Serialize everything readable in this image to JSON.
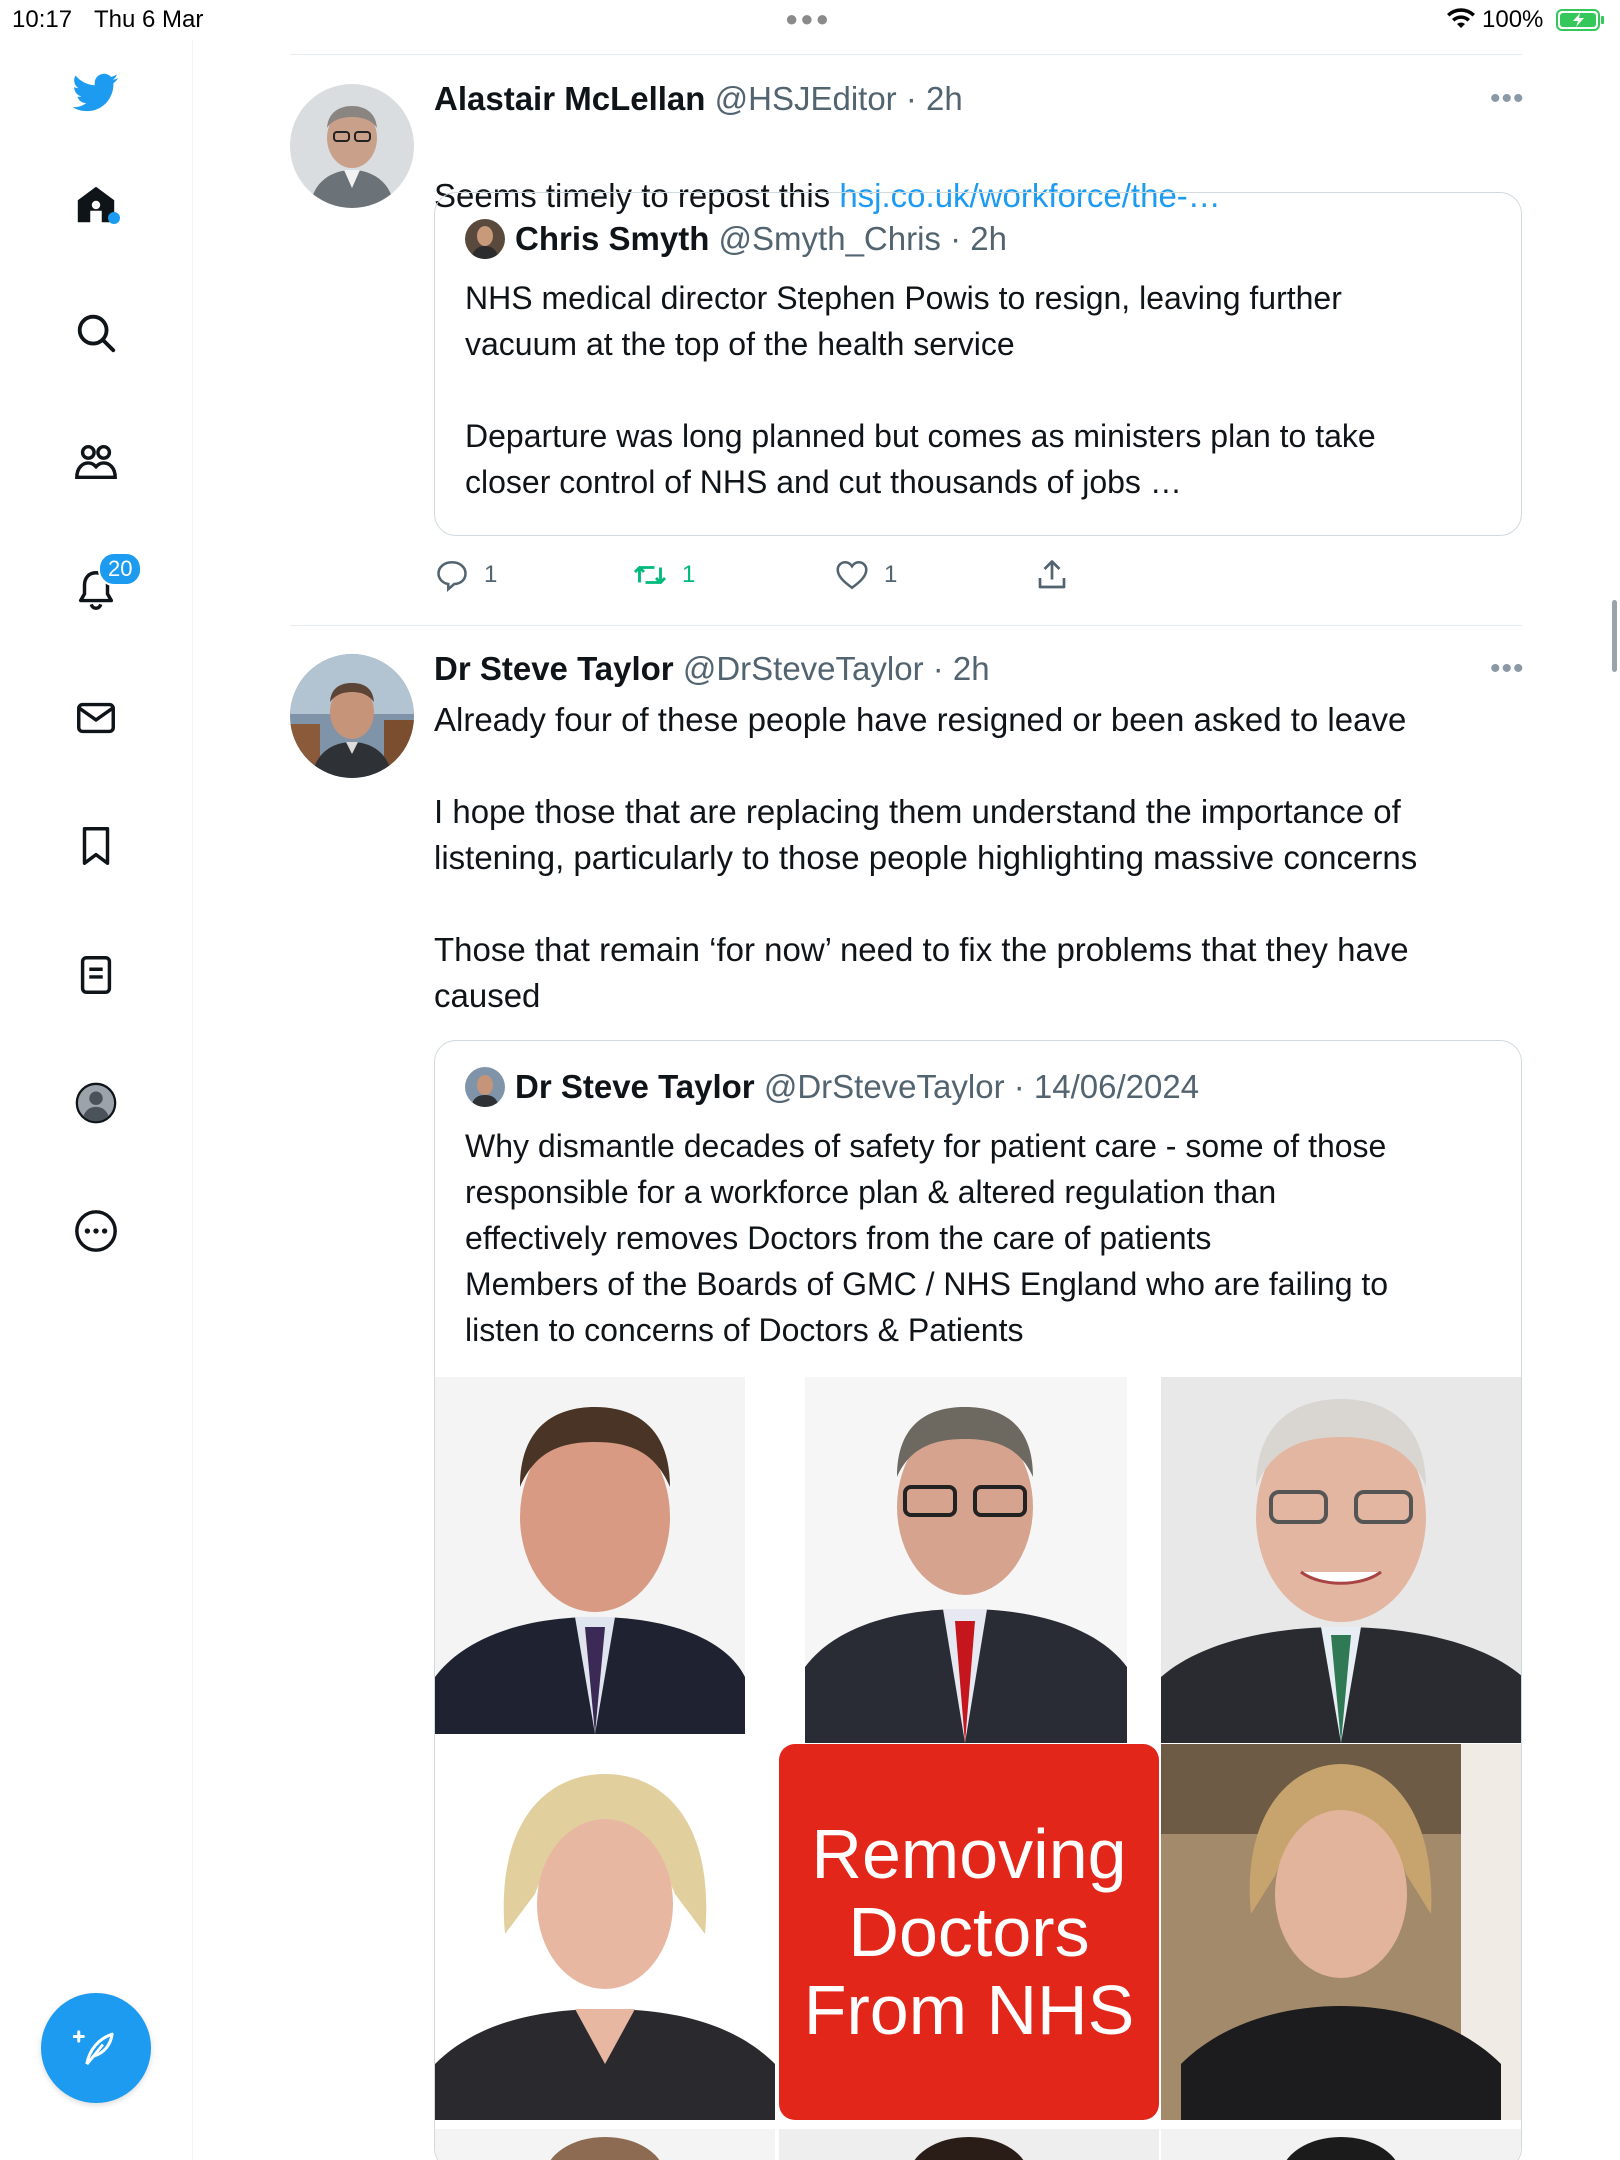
{
  "status_bar": {
    "time": "10:17",
    "date": "Thu 6 Mar",
    "battery": "100%"
  },
  "sidebar": {
    "notifications_badge": "20",
    "items": [
      "home-icon",
      "search-icon",
      "communities-icon",
      "notifications-icon",
      "messages-icon",
      "bookmarks-icon",
      "lists-icon",
      "profile-icon",
      "more-icon"
    ]
  },
  "colors": {
    "accent": "#1d9bf0",
    "retweet": "#00ba7c",
    "red": "#e2271a"
  },
  "tweets": [
    {
      "name": "Alastair McLellan",
      "handle": "@HSJEditor",
      "time": "· 2h",
      "text": "Seems timely to repost this ",
      "link": "hsj.co.uk/workforce/the-…",
      "quote": {
        "name": "Chris Smyth",
        "handle": "@Smyth_Chris",
        "time": "· 2h",
        "text": "NHS medical director Stephen Powis to resign, leaving further\nvacuum at the top of the health service\n\nDeparture was long planned but comes as ministers plan to take\ncloser control of NHS and cut thousands of jobs …"
      },
      "actions": {
        "replies": "1",
        "retweets": "1",
        "likes": "1"
      }
    },
    {
      "name": "Dr Steve Taylor",
      "handle": "@DrSteveTaylor",
      "time": "· 2h",
      "text": "Already four of these people have resigned or been asked to leave\n\nI hope those that are replacing them understand the importance of\nlistening, particularly to those people highlighting massive concerns\n\nThose that remain ‘for now’ need to fix the problems that they have\ncaused",
      "quote": {
        "name": "Dr Steve Taylor",
        "handle": "@DrSteveTaylor",
        "time": "· 14/06/2024",
        "text": "Why dismantle decades of safety for patient care - some of those\nresponsible for a workforce plan & altered regulation than\neffectively removes Doctors from the care of patients\nMembers of the Boards of GMC / NHS England who are failing to\nlisten to concerns of Doctors & Patients",
        "image_caption": "Removing\nDoctors\nFrom NHS"
      }
    }
  ]
}
